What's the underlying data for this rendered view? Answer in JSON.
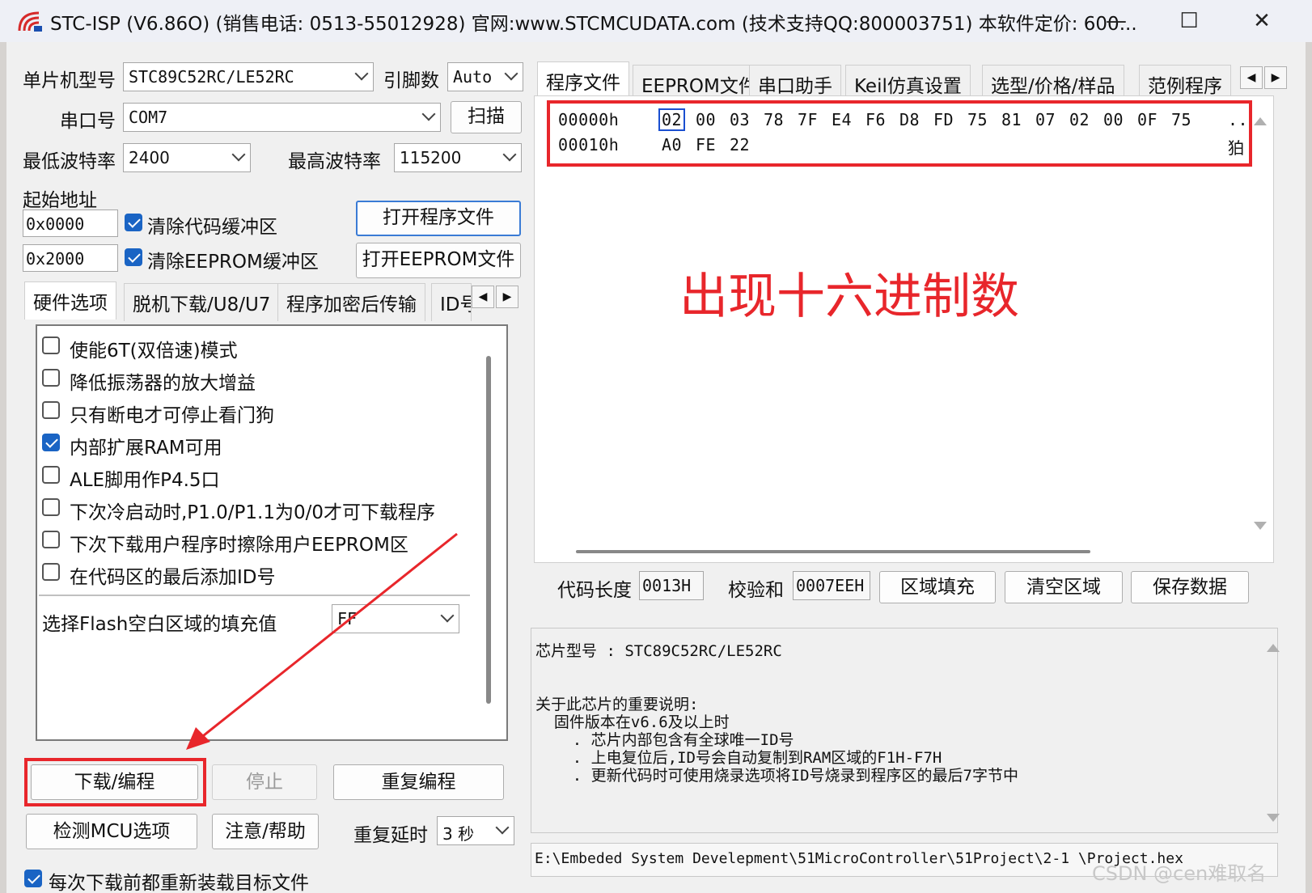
{
  "window": {
    "title": "STC-ISP (V6.86O) (销售电话: 0513-55012928) 官网:www.STCMCUDATA.com  (技术支持QQ:800003751) 本软件定价: 600...",
    "minimize": "—",
    "maximize": "☐",
    "close": "✕"
  },
  "left": {
    "mcu_type_label": "单片机型号",
    "mcu_type_value": "STC89C52RC/LE52RC",
    "pins_label": "引脚数",
    "pins_value": "Auto",
    "port_label": "串口号",
    "port_value": "COM7",
    "scan_button": "扫描",
    "min_baud_label": "最低波特率",
    "min_baud_value": "2400",
    "max_baud_label": "最高波特率",
    "max_baud_value": "115200",
    "start_addr_label": "起始地址",
    "code_addr": "0x0000",
    "clear_code_label": "清除代码缓冲区",
    "open_program_button": "打开程序文件",
    "eeprom_addr": "0x2000",
    "clear_eeprom_label": "清除EEPROM缓冲区",
    "open_eeprom_button": "打开EEPROM文件",
    "tabs": [
      "硬件选项",
      "脱机下载/U8/U7",
      "程序加密后传输",
      "ID号"
    ],
    "options": [
      {
        "label": "使能6T(双倍速)模式",
        "checked": false
      },
      {
        "label": "降低振荡器的放大增益",
        "checked": false
      },
      {
        "label": "只有断电才可停止看门狗",
        "checked": false
      },
      {
        "label": "内部扩展RAM可用",
        "checked": true
      },
      {
        "label": "ALE脚用作P4.5口",
        "checked": false
      },
      {
        "label": "下次冷启动时,P1.0/P1.1为0/0才可下载程序",
        "checked": false
      },
      {
        "label": "下次下载用户程序时擦除用户EEPROM区",
        "checked": false
      },
      {
        "label": "在代码区的最后添加ID号",
        "checked": false
      }
    ],
    "flash_fill_label": "选择Flash空白区域的填充值",
    "flash_fill_value": "FF",
    "download_button": "下载/编程",
    "stop_button": "停止",
    "repeat_button": "重复编程",
    "detect_button": "检测MCU选项",
    "help_button": "注意/帮助",
    "repeat_delay_label": "重复延时",
    "repeat_delay_value": "3 秒",
    "reload_label": "每次下载前都重新装载目标文件"
  },
  "right": {
    "tabs": [
      "程序文件",
      "EEPROM文件",
      "串口助手",
      "Keil仿真设置",
      "选型/价格/样品",
      "范例程序"
    ],
    "hex_rows": [
      {
        "addr": "00000h",
        "bytes": [
          "02",
          "00",
          "03",
          "78",
          "7F",
          "E4",
          "F6",
          "D8",
          "FD",
          "75",
          "81",
          "07",
          "02",
          "00",
          "0F",
          "75"
        ],
        "ascii": ".."
      },
      {
        "addr": "00010h",
        "bytes": [
          "A0",
          "FE",
          "22"
        ],
        "ascii": "狛"
      }
    ],
    "annotation": "出现十六进制数",
    "code_len_label": "代码长度",
    "code_len_value": "0013H",
    "checksum_label": "校验和",
    "checksum_value": "0007EEH",
    "fill_button": "区域填充",
    "clear_button": "清空区域",
    "save_button": "保存数据",
    "info_lines": [
      "芯片型号 : STC89C52RC/LE52RC",
      "",
      "关于此芯片的重要说明:",
      "  固件版本在v6.6及以上时",
      "    . 芯片内部包含有全球唯一ID号",
      "    . 上电复位后,ID号会自动复制到RAM区域的F1H-F7H",
      "    . 更新代码时可使用烧录选项将ID号烧录到程序区的最后7字节中"
    ],
    "file_path": "E:\\Embeded System Develepment\\51MicroController\\51Project\\2-1   \\Project.hex",
    "watermark": "CSDN @cen难取名"
  },
  "colors": {
    "accent": "#1a64c4",
    "annotation_red": "#e8262b"
  }
}
